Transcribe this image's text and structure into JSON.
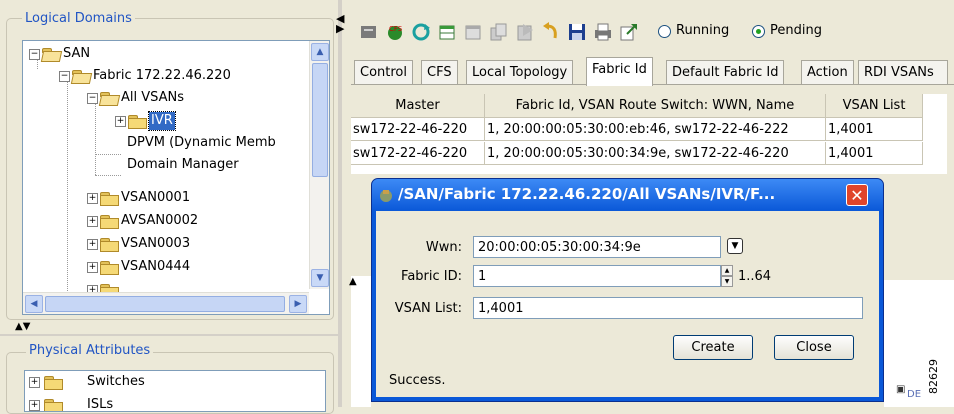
{
  "left_panel": {
    "logical_domains_title": "Logical Domains",
    "tree_nodes": [
      "SAN",
      "Fabric 172.22.46.220",
      "All VSANs",
      "IVR",
      "DPVM (Dynamic Memb",
      "Domain Manager",
      "VSAN0001",
      "AVSAN0002",
      "VSAN0003",
      "VSAN0444"
    ],
    "physical_attributes_title": "Physical Attributes",
    "physical_nodes": [
      "Switches",
      "ISLs"
    ]
  },
  "toolbar": {
    "icons": [
      "apply-icon",
      "cfs-icon",
      "refresh-icon",
      "create-row-icon",
      "delete-row-icon",
      "copy-icon",
      "paste-icon",
      "undo-icon",
      "save-icon",
      "print-icon",
      "export-icon"
    ],
    "radio_running": "Running",
    "radio_pending": "Pending",
    "selected_radio": "Pending"
  },
  "tabs": [
    "Control",
    "CFS",
    "Local Topology",
    "Fabric Id",
    "Default Fabric Id",
    "Action",
    "RDI VSANs"
  ],
  "active_tab": "Fabric Id",
  "table": {
    "columns": [
      "Master",
      "Fabric Id, VSAN Route Switch: WWN, Name",
      "VSAN List"
    ],
    "rows": [
      [
        "sw172-22-46-220",
        "1, 20:00:00:05:30:00:eb:46, sw172-22-46-222",
        "1,4001"
      ],
      [
        "sw172-22-46-220",
        "1, 20:00:00:05:30:00:34:9e, sw172-22-46-220",
        "1,4001"
      ]
    ]
  },
  "dialog": {
    "title": "/SAN/Fabric 172.22.46.220/All VSANs/IVR/F...",
    "wwn_label": "Wwn:",
    "wwn_value": "20:00:00:05:30:00:34:9e",
    "fabric_id_label": "Fabric ID:",
    "fabric_id_value": "1",
    "fabric_id_range": "1..64",
    "vsan_list_label": "VSAN List:",
    "vsan_list_value": "1,4001",
    "create_label": "Create",
    "close_label": "Close",
    "status": "Success."
  },
  "figure_number": "82629",
  "colors": {
    "title_blue": "#0a58d8",
    "link_blue": "#2155c4",
    "close_red": "#e0452b",
    "selection": "#316ac5"
  }
}
